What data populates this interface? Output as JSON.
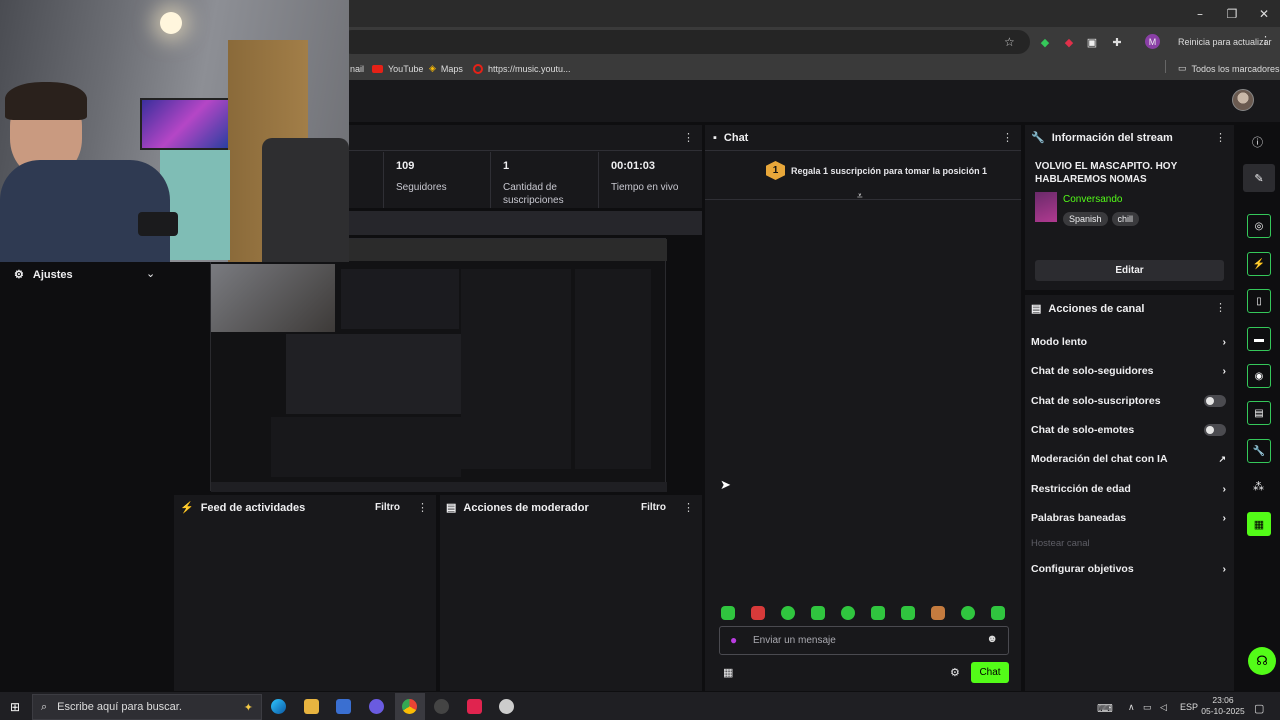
{
  "browser": {
    "bookmarks": [
      "nail",
      "YouTube",
      "Maps",
      "https://music.youtu..."
    ],
    "all_bookmarks": "Todos los marcadores",
    "update_button": "Reinicia para actualizar",
    "profile_initial": "M",
    "window_controls": [
      "–",
      "❐",
      "✕"
    ]
  },
  "stats": [
    {
      "value": "109",
      "label": "Seguidores"
    },
    {
      "value": "1",
      "label": "Cantidad de suscripciones"
    },
    {
      "value": "00:01:03",
      "label": "Tiempo en vivo"
    }
  ],
  "sidebar": {
    "ajustes": "Ajustes"
  },
  "feed": {
    "title": "Feed de actividades",
    "filter": "Filtro"
  },
  "moderator": {
    "title": "Acciones de moderador",
    "filter": "Filtro"
  },
  "chat": {
    "title": "Chat",
    "badge": "1",
    "gift_prompt": "Regala 1 suscripción para tomar la posición 1",
    "placeholder": "Enviar un mensaje",
    "send_label": "Chat"
  },
  "stream_info": {
    "title": "Información del stream",
    "stream_title": "VOLVIO EL MASCAPITO. HOY HABLAREMOS NOMAS",
    "category": "Conversando",
    "tags": [
      "Spanish",
      "chill"
    ],
    "edit_label": "Editar",
    "category_color": "#53fc18"
  },
  "channel_actions": {
    "title": "Acciones de canal",
    "items": [
      {
        "label": "Modo lento",
        "control": "chevron"
      },
      {
        "label": "Chat de solo-seguidores",
        "control": "chevron"
      },
      {
        "label": "Chat de solo-suscriptores",
        "control": "toggle-off"
      },
      {
        "label": "Chat de solo-emotes",
        "control": "toggle-off"
      },
      {
        "label": "Moderación del chat con IA",
        "control": "external"
      },
      {
        "label": "Restricción de edad",
        "control": "chevron"
      },
      {
        "label": "Palabras baneadas",
        "control": "chevron"
      },
      {
        "label": "Hostear canal",
        "control": "disabled"
      },
      {
        "label": "Configurar objetivos",
        "control": "chevron"
      }
    ]
  },
  "taskbar": {
    "search_placeholder": "Escribe aquí para buscar.",
    "language": "ESP",
    "time": "23:06",
    "date": "05-10-2025"
  },
  "accent_color": "#53fc18"
}
